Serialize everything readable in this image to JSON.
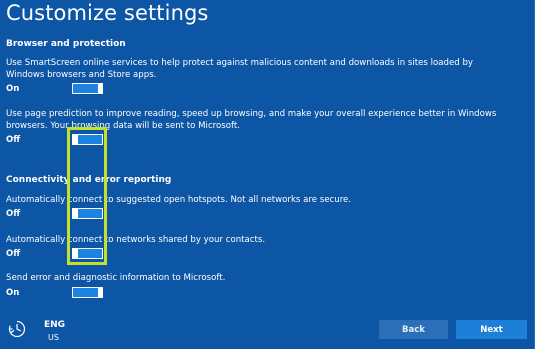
{
  "page": {
    "title": "Customize settings"
  },
  "sections": {
    "browser": {
      "header": "Browser and protection",
      "smartscreen": {
        "description": "Use SmartScreen online services to help protect against malicious content and downloads in sites loaded by Windows browsers and Store apps.",
        "state": "On",
        "value": true
      },
      "page_prediction": {
        "description": "Use page prediction to improve reading, speed up browsing, and make your overall experience better in Windows browsers. Your browsing data will be sent to Microsoft.",
        "state": "Off",
        "value": false
      }
    },
    "connectivity": {
      "header": "Connectivity and error reporting",
      "hotspots": {
        "description": "Automatically connect to suggested open hotspots. Not all networks are secure.",
        "state": "Off",
        "value": false
      },
      "contacts": {
        "description": "Automatically connect to networks shared by your contacts.",
        "state": "Off",
        "value": false
      },
      "error_reporting": {
        "description": "Send error and diagnostic information to Microsoft.",
        "state": "On",
        "value": true
      }
    }
  },
  "footer": {
    "accessibility_icon": "ease-of-access-icon",
    "language": "ENG",
    "region": "US",
    "back_label": "Back",
    "next_label": "Next"
  },
  "colors": {
    "background": "#0d56a6",
    "toggle_fill": "#1c84e0",
    "highlight": "#c4e02b",
    "next_button": "#1e7fd9",
    "back_button": "#2a6fb8"
  }
}
